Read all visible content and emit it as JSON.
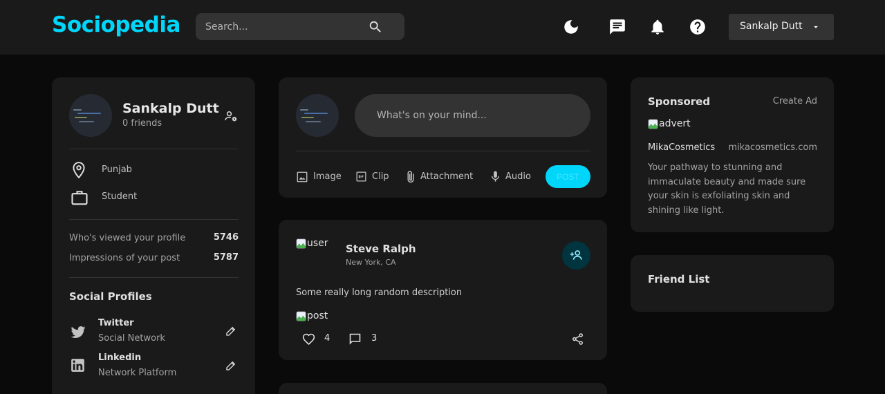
{
  "navbar": {
    "logo": "Sociopedia",
    "search_placeholder": "Search...",
    "user_name": "Sankalp Dutt"
  },
  "user_widget": {
    "name": "Sankalp Dutt",
    "friends": "0 friends",
    "location": "Punjab",
    "occupation": "Student",
    "stats": [
      {
        "label": "Who's viewed your profile",
        "value": "5746"
      },
      {
        "label": "Impressions of your post",
        "value": "5787"
      }
    ],
    "social_title": "Social Profiles",
    "socials": [
      {
        "name": "Twitter",
        "sub": "Social Network"
      },
      {
        "name": "Linkedin",
        "sub": "Network Platform"
      }
    ]
  },
  "composer": {
    "placeholder": "What's on your mind...",
    "actions": [
      "Image",
      "Clip",
      "Attachment",
      "Audio"
    ],
    "post_label": "POST"
  },
  "post": {
    "avatar_alt": "user",
    "name": "Steve Ralph",
    "location": "New York, CA",
    "description": "Some really long random description",
    "image_alt": "post",
    "likes": "4",
    "comments": "3"
  },
  "ad": {
    "title": "Sponsored",
    "create": "Create Ad",
    "image_alt": "advert",
    "brand": "MikaCosmetics",
    "url": "mikacosmetics.com",
    "description_lines": [
      "Your pathway to stunning and",
      "immaculate beauty and made sure",
      "your skin is exfoliating skin and",
      "shining like light."
    ]
  },
  "friends": {
    "title": "Friend List"
  },
  "colors": {
    "primary": "#00d5fa",
    "background": "#0a0a0a",
    "card": "#1a1a1a",
    "input": "#333333"
  }
}
